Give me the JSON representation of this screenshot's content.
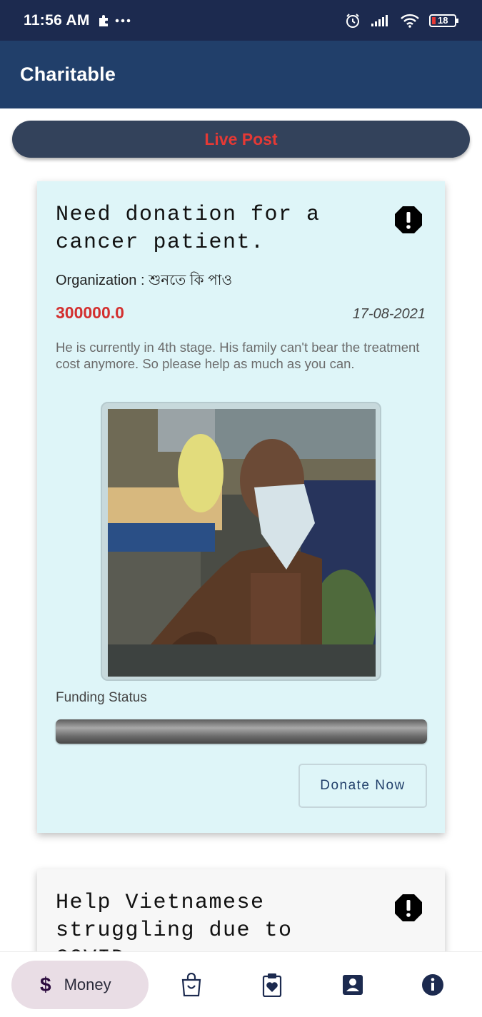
{
  "status_bar": {
    "time": "11:56 AM",
    "battery": "18"
  },
  "app_bar": {
    "title": "Charitable"
  },
  "live_post": {
    "label": "Live Post"
  },
  "posts": [
    {
      "title": "Need donation for a cancer patient.",
      "organization": "Organization : শুনতে কি পাও",
      "amount": "300000.0",
      "date": "17-08-2021",
      "description": "He is currently in 4th stage. His family can't bear the treatment cost anymore. So please help as much as you can.",
      "funding_label": "Funding Status",
      "funding_progress": 0,
      "donate_label": "Donate Now"
    },
    {
      "title": "Help Vietnamese struggling due to COVID"
    }
  ],
  "bottom_nav": {
    "money_label": "Money",
    "money_icon": "$"
  },
  "colors": {
    "status_bar": "#1c2a4f",
    "app_bar": "#213f6a",
    "live_post_bg": "#33425b",
    "live_post_text": "#e53935",
    "card_bg": "#def5f8",
    "amount": "#d32f2f",
    "nav_active_bg": "#e9dde5"
  }
}
